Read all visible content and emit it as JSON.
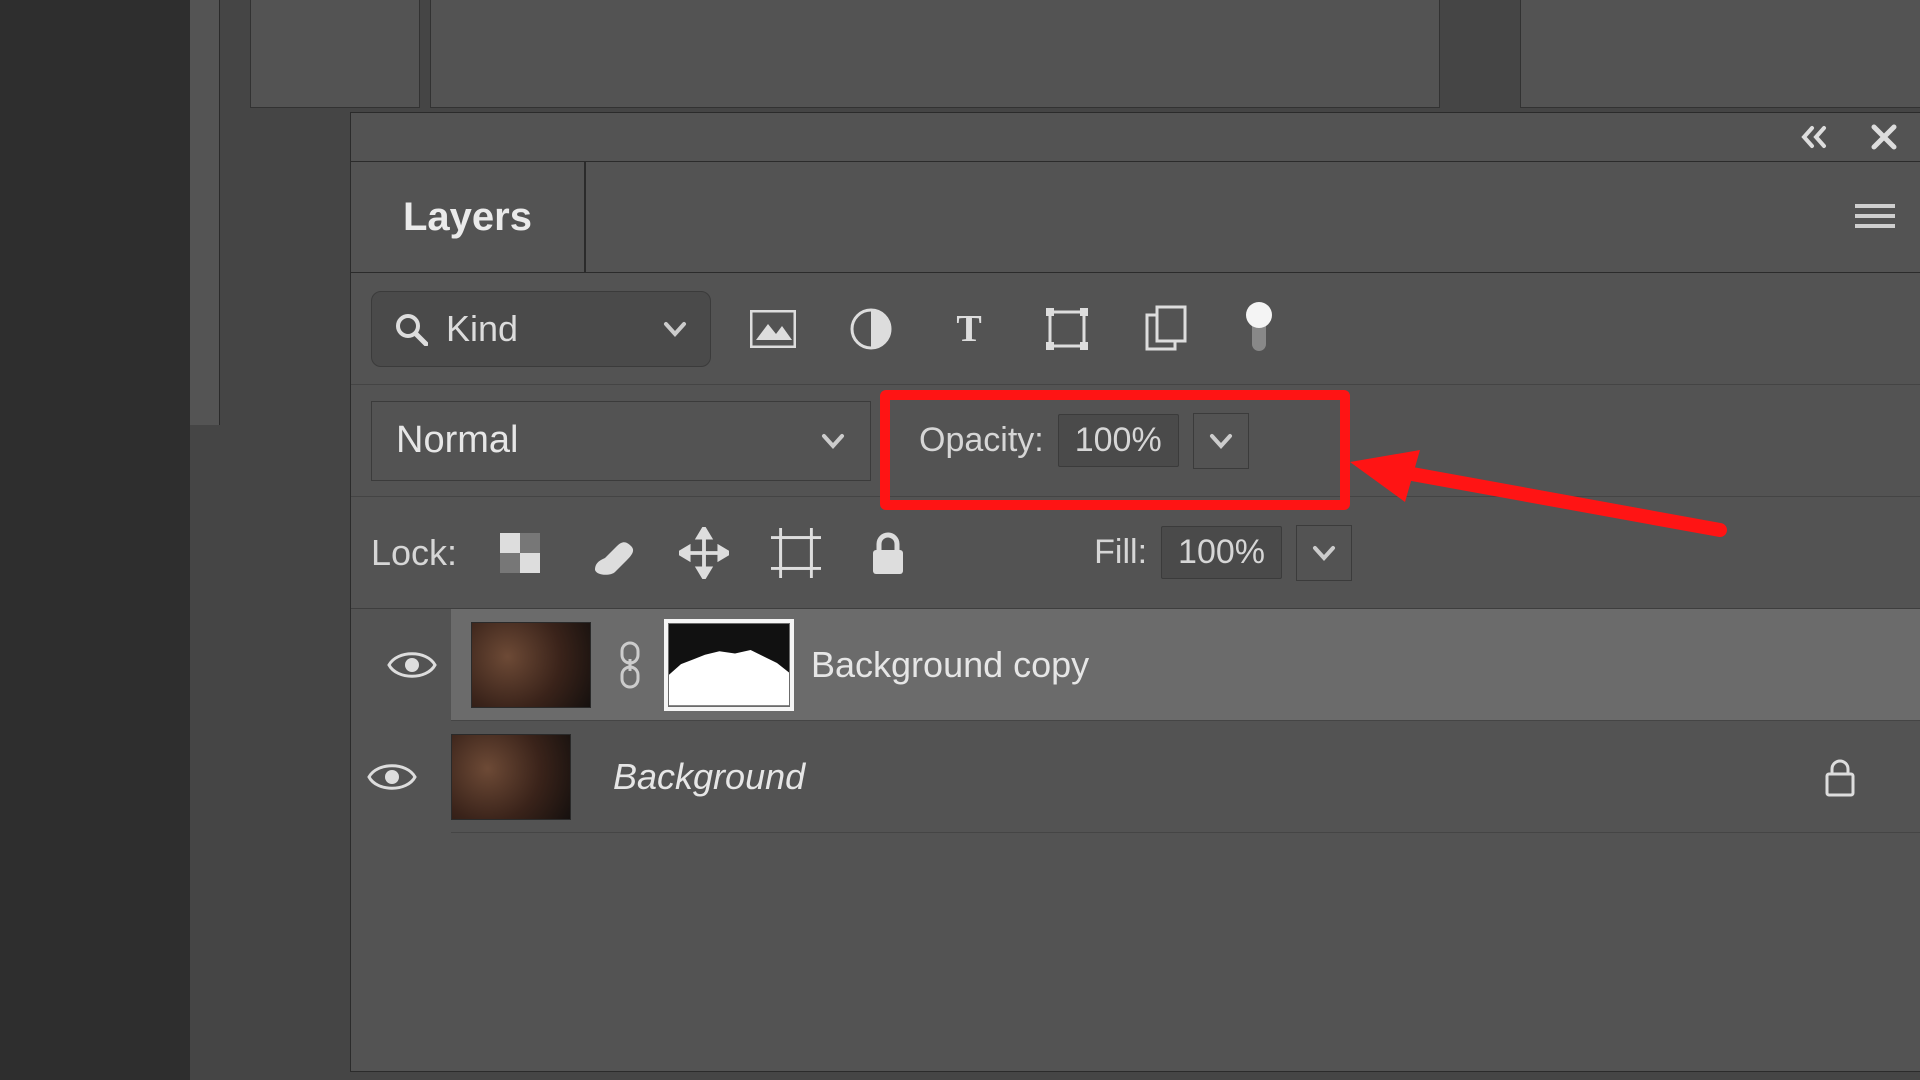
{
  "panel": {
    "tab_label": "Layers",
    "filter": {
      "kind_label": "Kind"
    },
    "blend_mode": "Normal",
    "opacity": {
      "label": "Opacity:",
      "value": "100%"
    },
    "fill": {
      "label": "Fill:",
      "value": "100%"
    },
    "lock_label": "Lock:"
  },
  "layers": [
    {
      "name": "Background copy",
      "selected": true,
      "has_mask": true,
      "locked": false
    },
    {
      "name": "Background",
      "selected": false,
      "has_mask": false,
      "locked": true
    }
  ],
  "annotation": {
    "highlight_target": "opacity-control"
  }
}
